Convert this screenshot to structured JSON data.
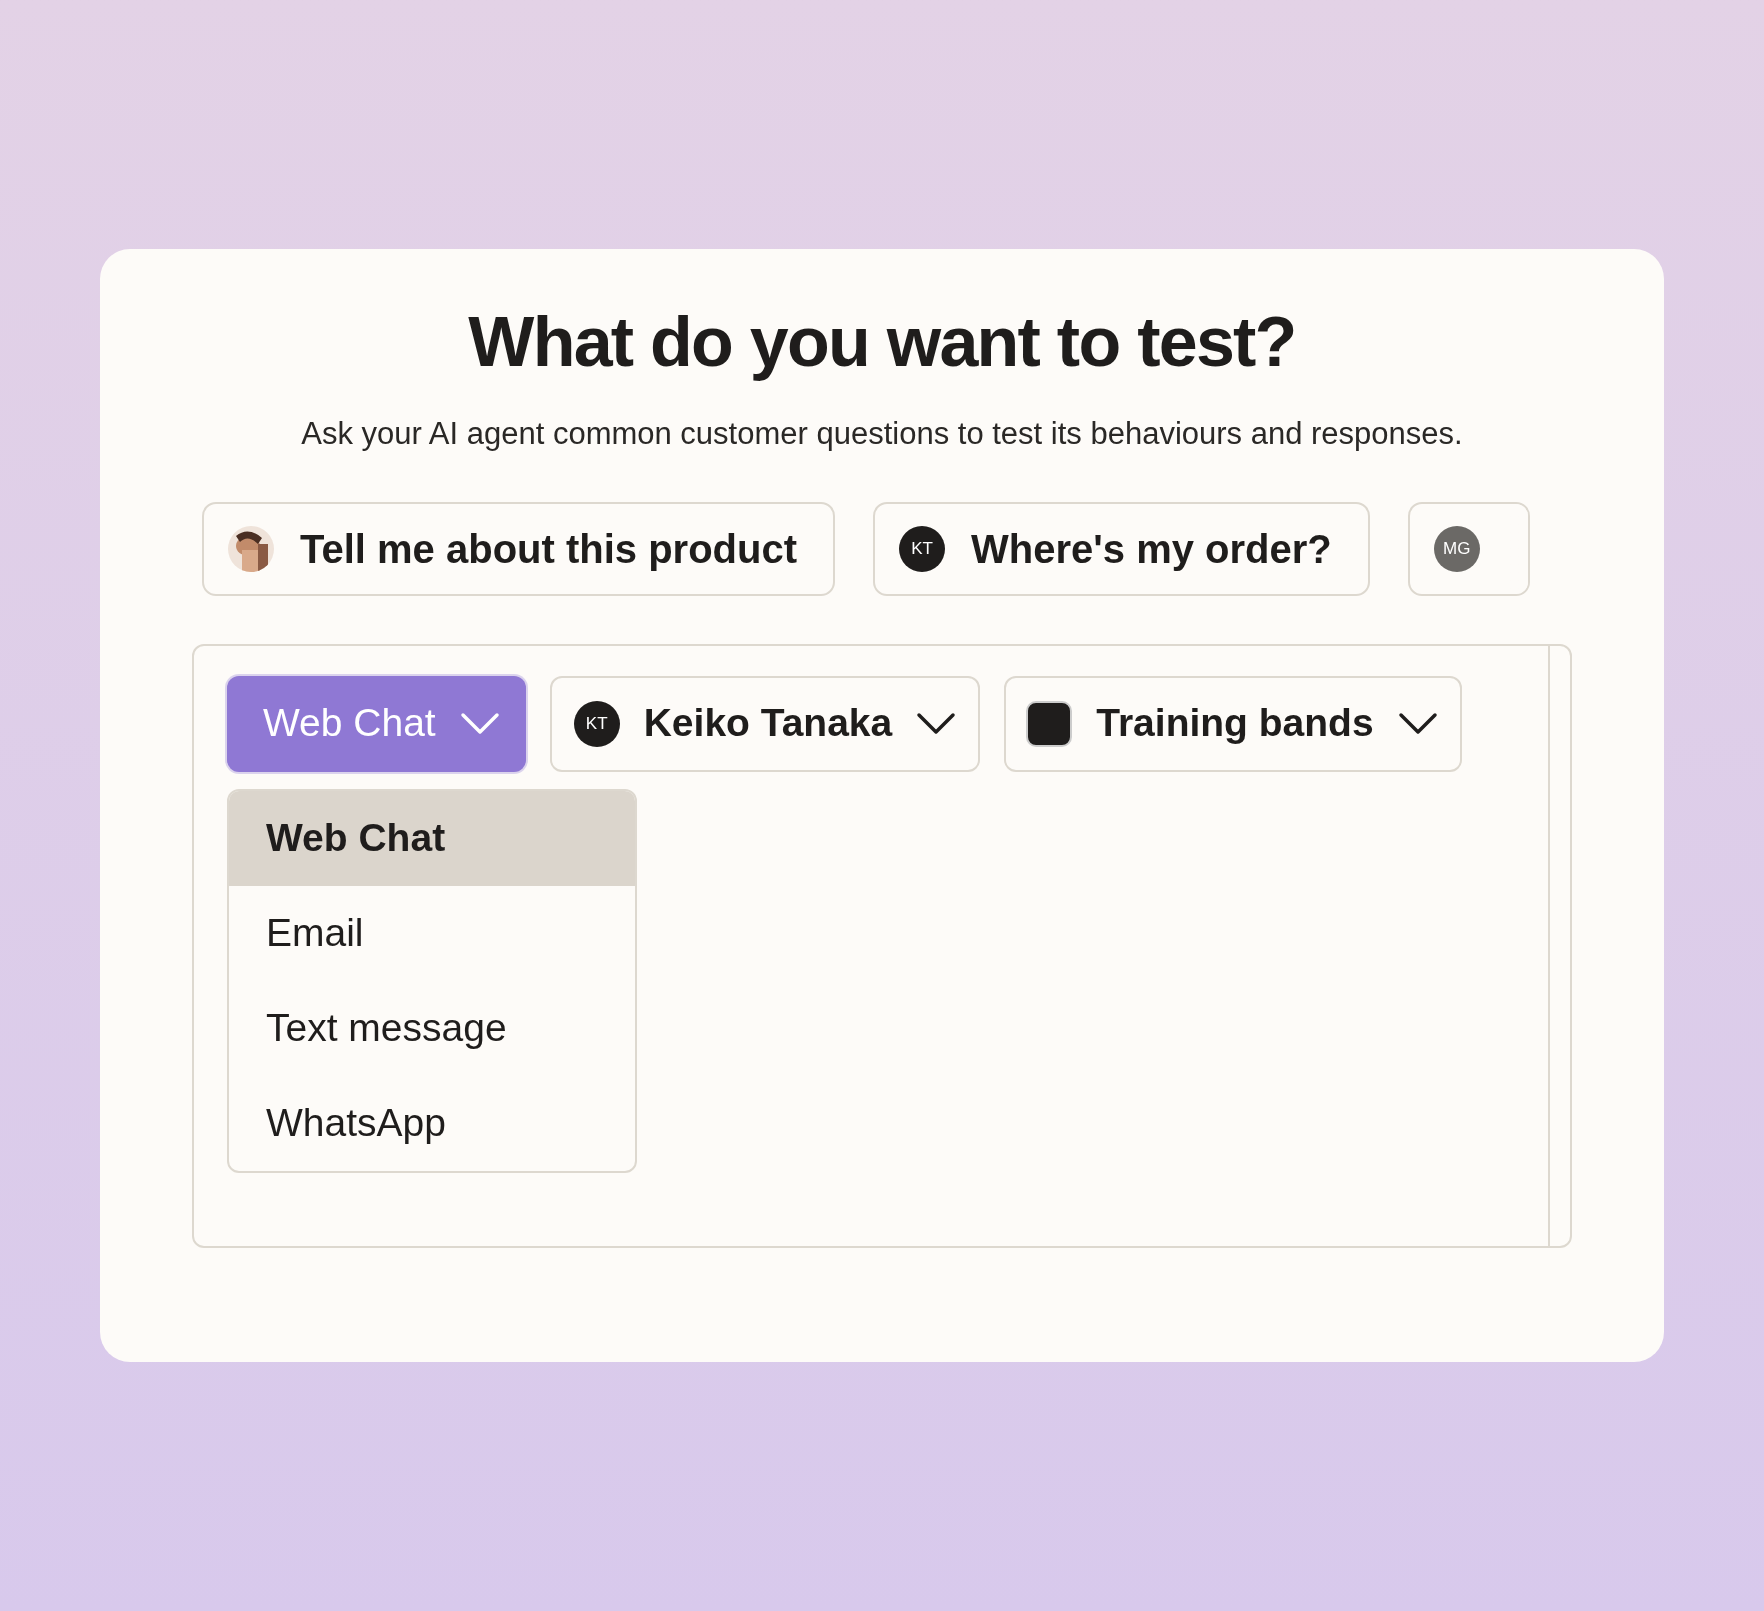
{
  "title": "What do you want to test?",
  "subtitle": "Ask your AI agent common customer questions to test its behaviours and responses.",
  "suggestions": [
    {
      "label": "Tell me about this product"
    },
    {
      "avatar": {
        "kind": "initials",
        "text": "KT",
        "color": "#1f1d1c"
      },
      "label": "Where's my order?"
    },
    {
      "avatar": {
        "kind": "initials",
        "text": "MG",
        "color": "#6b6966"
      },
      "cut": true
    }
  ],
  "selectors": [
    {
      "kind": "channel",
      "label": "Web Chat",
      "open": true
    },
    {
      "kind": "person",
      "initials": "KT",
      "label": "Keiko Tanaka",
      "open": false
    },
    {
      "kind": "product",
      "label": "Training bands",
      "open": false
    }
  ],
  "channel_menu": [
    {
      "label": "Web Chat",
      "selected": true
    },
    {
      "label": "Email",
      "selected": false
    },
    {
      "label": "Text message",
      "selected": false
    },
    {
      "label": "WhatsApp",
      "selected": false
    }
  ]
}
